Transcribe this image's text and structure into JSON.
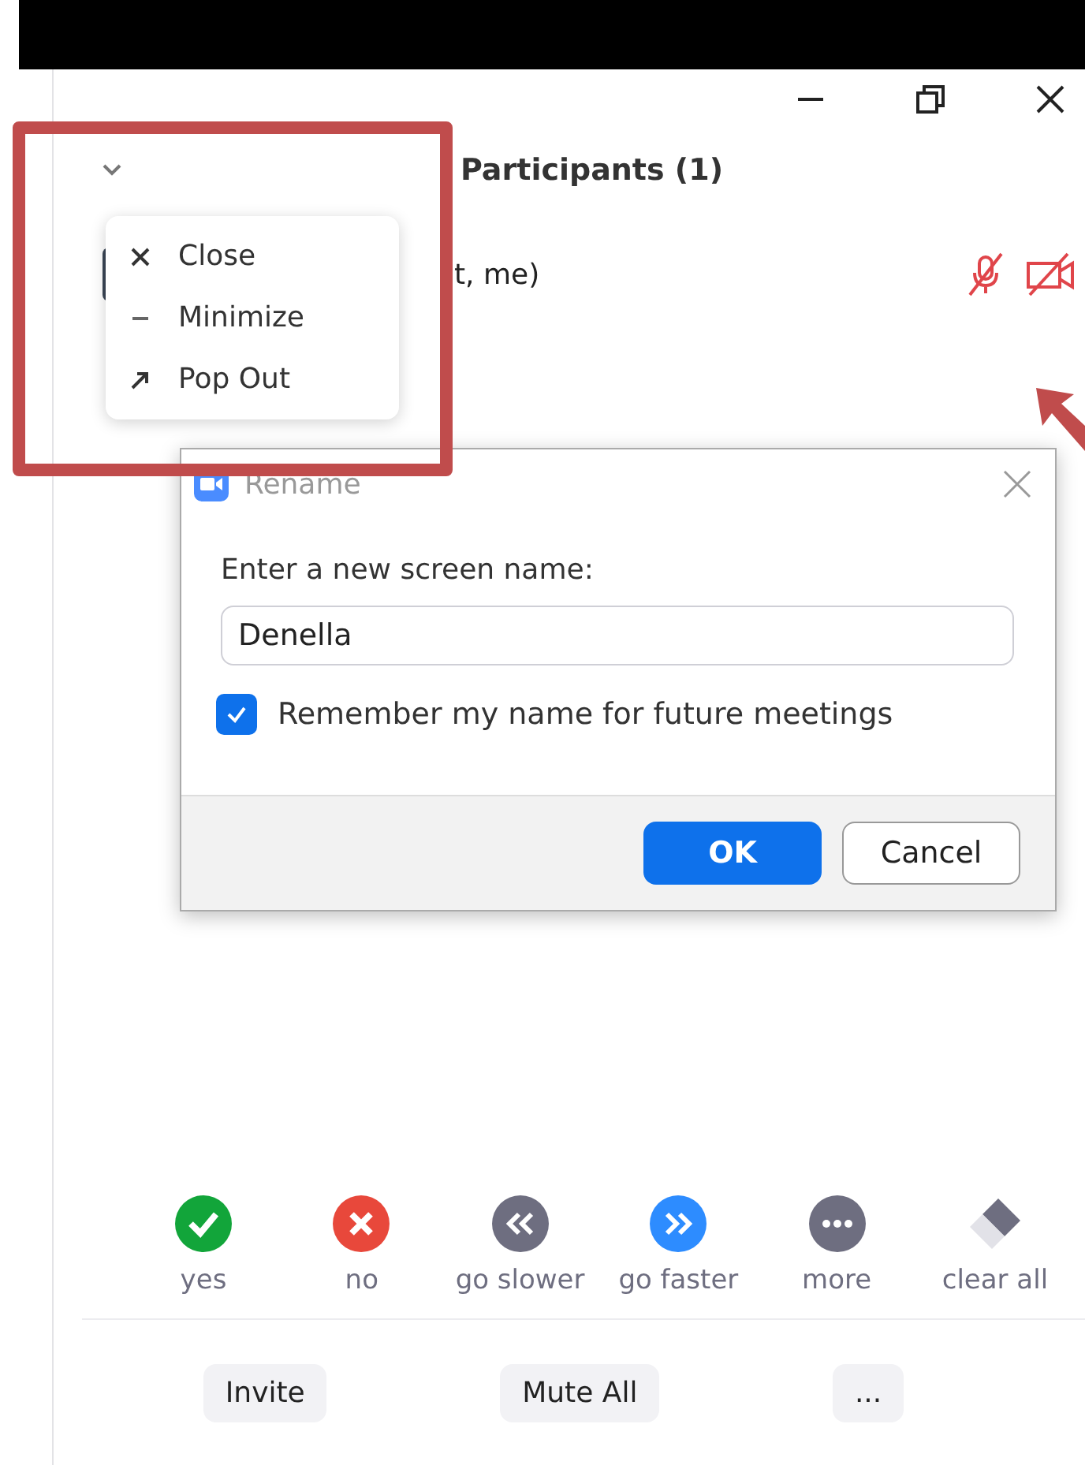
{
  "panel": {
    "title": "Participants (1)"
  },
  "participants": [
    {
      "name": "t, me)",
      "audio_muted": true,
      "video_off": true
    }
  ],
  "context_menu": [
    {
      "kind": "close",
      "label": "Close"
    },
    {
      "kind": "minimize",
      "label": "Minimize"
    },
    {
      "kind": "popout",
      "label": "Pop Out"
    }
  ],
  "dialog": {
    "title": "Rename",
    "prompt": "Enter a new screen name:",
    "value": "Denella",
    "remember": {
      "label": "Remember my name for future meetings",
      "checked": true
    },
    "buttons": [
      {
        "label": "OK",
        "primary": true
      },
      {
        "label": "Cancel",
        "primary": false
      }
    ]
  },
  "reactions": [
    {
      "kind": "check",
      "label": "yes",
      "color": "#12a53a"
    },
    {
      "kind": "cross",
      "label": "no",
      "color": "#e8483b"
    },
    {
      "kind": "rewind",
      "label": "go slower",
      "color": "#6e6e80"
    },
    {
      "kind": "forward",
      "label": "go faster",
      "color": "#2d8cff"
    },
    {
      "kind": "dots",
      "label": "more",
      "color": "#6e6e80"
    },
    {
      "kind": "eraser",
      "label": "clear all",
      "color": "#6e6e80"
    }
  ],
  "footer_buttons": [
    "Invite",
    "Mute All",
    "..."
  ]
}
